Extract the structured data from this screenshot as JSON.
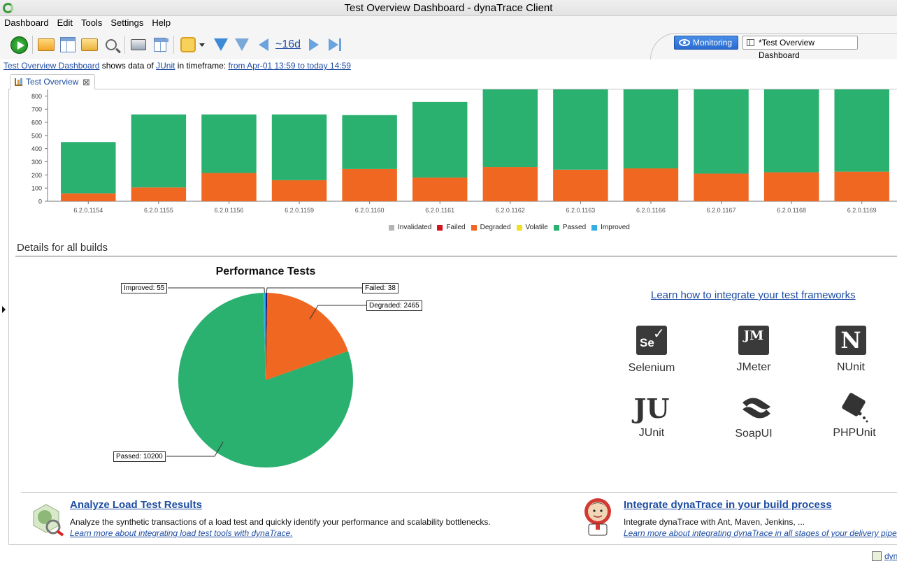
{
  "window": {
    "title": "Test Overview Dashboard - dynaTrace Client"
  },
  "menu": [
    "Dashboard",
    "Edit",
    "Tools",
    "Settings",
    "Help"
  ],
  "toolbar": {
    "timeframe_label": "~16d",
    "perspective_button": "Monitoring",
    "dashboard_button": "*Test Overview Dashboard"
  },
  "infoline": {
    "dashboard_link": "Test Overview Dashboard",
    "shows_text": " shows data of ",
    "junit_link": "JUnit",
    "in_timeframe_text": " in timeframe: ",
    "timeframe_link": "from Apr-01 13:59 to today 14:59"
  },
  "tab": {
    "label": "Test Overview",
    "close": "⊠"
  },
  "chart_data": [
    {
      "type": "bar",
      "stacked": true,
      "categories": [
        "6.2.0.1154",
        "6.2.0.1155",
        "6.2.0.1156",
        "6.2.0.1159",
        "6.2.0.1160",
        "6.2.0.1161",
        "6.2.0.1162",
        "6.2.0.1163",
        "6.2.0.1166",
        "6.2.0.1167",
        "6.2.0.1168",
        "6.2.0.1169"
      ],
      "series": [
        {
          "name": "Invalidated",
          "color": "#b5b5b5",
          "values": [
            0,
            0,
            0,
            0,
            0,
            0,
            0,
            0,
            0,
            0,
            0,
            0
          ]
        },
        {
          "name": "Failed",
          "color": "#d3141d",
          "values": [
            0,
            0,
            0,
            0,
            0,
            0,
            0,
            0,
            0,
            0,
            0,
            0
          ]
        },
        {
          "name": "Degraded",
          "color": "#ef6720",
          "values": [
            60,
            105,
            215,
            160,
            245,
            180,
            260,
            240,
            250,
            210,
            220,
            225
          ]
        },
        {
          "name": "Volatile",
          "color": "#f2df1f",
          "values": [
            0,
            0,
            0,
            0,
            0,
            0,
            0,
            0,
            0,
            0,
            0,
            0
          ]
        },
        {
          "name": "Passed",
          "color": "#2ab06f",
          "values": [
            390,
            555,
            445,
            500,
            410,
            575,
            600,
            620,
            610,
            650,
            640,
            635
          ]
        },
        {
          "name": "Improved",
          "color": "#35aee6",
          "values": [
            0,
            0,
            0,
            0,
            0,
            0,
            0,
            0,
            0,
            0,
            0,
            0
          ]
        }
      ],
      "yticks": [
        0,
        100,
        200,
        300,
        400,
        500,
        600,
        700,
        800
      ],
      "ylim": [
        0,
        850
      ],
      "grid": false,
      "legend": "bottom"
    },
    {
      "type": "pie",
      "title": "Performance Tests",
      "slices": [
        {
          "label": "Failed",
          "value": 38,
          "color": "#1b1b7a"
        },
        {
          "label": "Degraded",
          "value": 2465,
          "color": "#ef6720"
        },
        {
          "label": "Passed",
          "value": 10200,
          "color": "#2ab06f"
        },
        {
          "label": "Improved",
          "value": 55,
          "color": "#35aee6"
        }
      ],
      "callouts": [
        "Improved: 55",
        "Failed: 38",
        "Degraded: 2465",
        "Passed: 10200"
      ]
    }
  ],
  "details": {
    "heading": "Details for all builds",
    "learn_link": "Learn how to integrate your test frameworks",
    "frameworks": [
      {
        "name": "Selenium",
        "icon": "selenium-icon",
        "glyph": "Se"
      },
      {
        "name": "JMeter",
        "icon": "jmeter-icon",
        "glyph": "JM"
      },
      {
        "name": "NUnit",
        "icon": "nunit-icon",
        "glyph": "N"
      },
      {
        "name": "JUnit",
        "icon": "junit-icon",
        "glyph": "JU"
      },
      {
        "name": "SoapUI",
        "icon": "soapui-icon",
        "glyph": "S"
      },
      {
        "name": "PHPUnit",
        "icon": "phpunit-icon",
        "glyph": ""
      }
    ]
  },
  "promos": {
    "load": {
      "title": "Analyze Load Test Results",
      "text": "Analyze the synthetic transactions of a load test and quickly identify your performance and scalability bottlenecks.",
      "link": "Learn more about integrating load test tools with dynaTrace."
    },
    "build": {
      "title": "Integrate dynaTrace in your build process",
      "text": "Integrate dynaTrace with Ant, Maven, Jenkins, ...",
      "link": "Learn more about integrating dynaTrace in all stages of your delivery pipel"
    }
  },
  "status": {
    "link": "dyn"
  }
}
